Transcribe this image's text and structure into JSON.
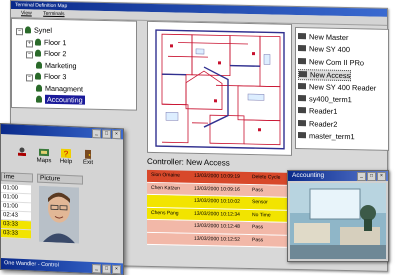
{
  "app": {
    "title": "Terminal Definition Map",
    "menu": [
      "View",
      "Terminals"
    ]
  },
  "tree": {
    "items": [
      {
        "label": "Synel",
        "depth": 0,
        "expander": "−"
      },
      {
        "label": "Floor 1",
        "depth": 1,
        "expander": "+"
      },
      {
        "label": "Floor 2",
        "depth": 1,
        "expander": "−"
      },
      {
        "label": "Marketing",
        "depth": 2,
        "expander": ""
      },
      {
        "label": "Floor 3",
        "depth": 1,
        "expander": "−"
      },
      {
        "label": "Managment",
        "depth": 2,
        "expander": ""
      },
      {
        "label": "Accounting",
        "depth": 2,
        "expander": "",
        "selected": true
      }
    ]
  },
  "devices": {
    "items": [
      {
        "label": "New Master"
      },
      {
        "label": "New SY 400"
      },
      {
        "label": "New Com II PRo"
      },
      {
        "label": "New Access",
        "selected": true
      },
      {
        "label": "New SY 400 Reader"
      },
      {
        "label": "sy400_term1"
      },
      {
        "label": "Reader1"
      },
      {
        "label": "Reader2"
      },
      {
        "label": "master_term1"
      }
    ]
  },
  "controller": {
    "label": "Controller:",
    "value": "New Access"
  },
  "events": {
    "rows": [
      {
        "name": "Sion Omaine",
        "time": "13/03/2000 10:09:19",
        "status": "Delete Cycle",
        "color": "#d8482a"
      },
      {
        "name": "Chen Katzen",
        "time": "13/03/2000 10:09:16",
        "status": "Pass",
        "color": "#f2b8a8"
      },
      {
        "name": "",
        "time": "13/03/2000 10:10:02",
        "status": "Sensor",
        "color": "#f2e400"
      },
      {
        "name": "Chens Pang",
        "time": "13/03/2000 10:12:34",
        "status": "No Time",
        "color": "#f2e400"
      },
      {
        "name": "",
        "time": "13/03/2000 10:12:48",
        "status": "Pass",
        "color": "#f2b8a8"
      },
      {
        "name": "",
        "time": "13/03/2000 10:12:52",
        "status": "Pass",
        "color": "#f2b8a8"
      }
    ]
  },
  "accounting_window": {
    "title": "Accounting"
  },
  "personnel_window": {
    "tools": [
      {
        "label": "",
        "icon": "user-icon"
      },
      {
        "label": "Maps",
        "icon": "map-icon"
      },
      {
        "label": "Help",
        "icon": "help-icon"
      },
      {
        "label": "Exit",
        "icon": "exit-icon"
      }
    ],
    "headers": {
      "time": "ime",
      "picture": "Picture"
    },
    "times": [
      "01:00",
      "01:00",
      "01:00",
      "02:43",
      "03:33",
      "03:33"
    ],
    "bottom_title": "One Wandler - Control"
  },
  "window_buttons": {
    "min": "_",
    "max": "□",
    "close": "×"
  },
  "colors": {
    "titlebar": "#0a2a8a",
    "selection": "#1a1a9a"
  }
}
